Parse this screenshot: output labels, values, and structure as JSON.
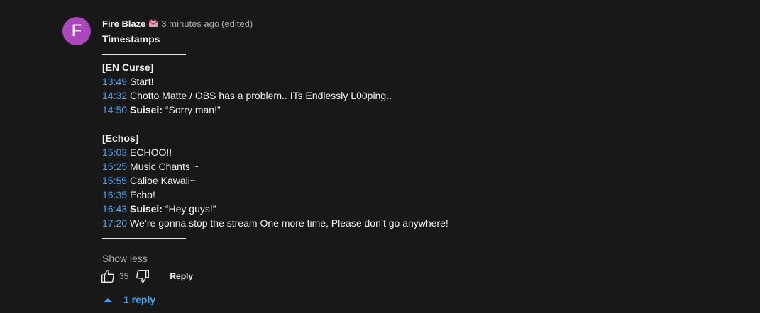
{
  "comment": {
    "avatar_letter": "F",
    "avatar_color": "#ab47bc",
    "author": "Fire Blaze",
    "author_badge_icon": "member-badge-icon",
    "timestamp": "3 minutes ago",
    "edited": "(edited)",
    "heading": "Timestamps",
    "divider": "—————————",
    "sections": {
      "en_curse": {
        "title": "[EN Curse]",
        "items": [
          {
            "time": "13:49",
            "speaker": "",
            "text": "Start!"
          },
          {
            "time": "14:32",
            "speaker": "",
            "text": "Chotto Matte / OBS has a problem.. ITs Endlessly L00ping.."
          },
          {
            "time": "14:50",
            "speaker": "Suisei:",
            "text": "“Sorry man!”"
          }
        ]
      },
      "echos": {
        "title": "[Echos]",
        "items": [
          {
            "time": "15:03",
            "speaker": "",
            "text": "ECHOO!!"
          },
          {
            "time": "15:25",
            "speaker": "",
            "text": "Music Chants ~"
          },
          {
            "time": "15:55",
            "speaker": "",
            "text": "Calioe Kawaii~"
          },
          {
            "time": "16:35",
            "speaker": "",
            "text": "Echo!"
          },
          {
            "time": "16:43",
            "speaker": "Suisei:",
            "text": "“Hey guys!”"
          },
          {
            "time": "17:20",
            "speaker": "",
            "text": "We’re gonna stop the stream One more time, Please don’t go anywhere!"
          }
        ]
      }
    },
    "show_less": "Show less",
    "like_count": "35",
    "reply_label": "Reply",
    "replies_label": "1 reply"
  },
  "colors": {
    "background": "#181818",
    "link": "#3ea6ff",
    "text": "#f1f1f1",
    "muted": "#aaaaaa"
  }
}
